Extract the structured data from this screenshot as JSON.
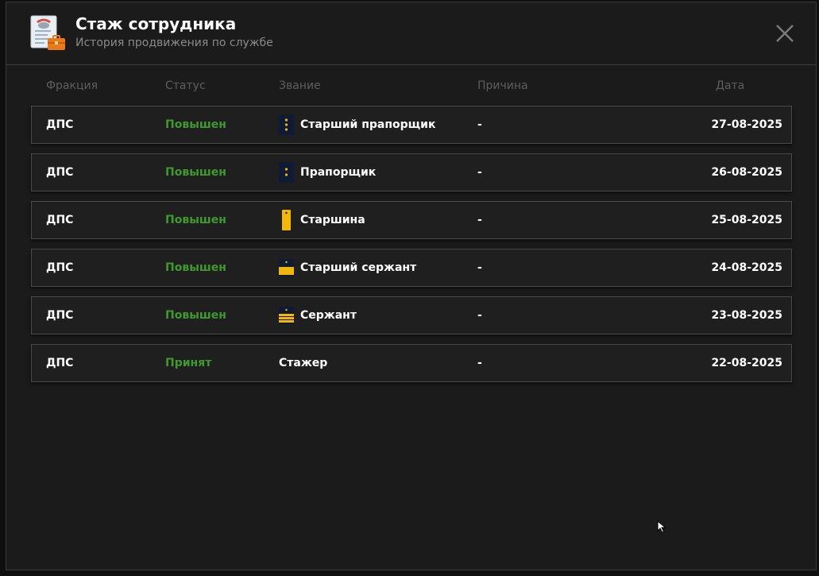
{
  "header": {
    "title": "Стаж сотрудника",
    "subtitle": "История продвижения по службе"
  },
  "columns": {
    "faction": "Фракция",
    "status": "Статус",
    "rank": "Звание",
    "reason": "Причина",
    "date": "Дата"
  },
  "rows": [
    {
      "faction": "ДПС",
      "status": "Повышен",
      "rank": "Старший прапорщик",
      "rank_icon": "ensign-3-stars-icon",
      "reason": "-",
      "date": "27-08-2025"
    },
    {
      "faction": "ДПС",
      "status": "Повышен",
      "rank": "Прапорщик",
      "rank_icon": "ensign-2-stars-icon",
      "reason": "-",
      "date": "26-08-2025"
    },
    {
      "faction": "ДПС",
      "status": "Повышен",
      "rank": "Старшина",
      "rank_icon": "starshina-stripe-icon",
      "reason": "-",
      "date": "25-08-2025"
    },
    {
      "faction": "ДПС",
      "status": "Повышен",
      "rank": "Старший сержант",
      "rank_icon": "senior-sergeant-wide-stripe-icon",
      "reason": "-",
      "date": "24-08-2025"
    },
    {
      "faction": "ДПС",
      "status": "Повышен",
      "rank": "Сержант",
      "rank_icon": "sergeant-three-stripes-icon",
      "reason": "-",
      "date": "23-08-2025"
    },
    {
      "faction": "ДПС",
      "status": "Принят",
      "rank": "Стажер",
      "rank_icon": "",
      "reason": "-",
      "date": "22-08-2025"
    }
  ],
  "colors": {
    "status_green": "#3f9a2c",
    "rank_gold": "#f3b70b",
    "rank_navy": "#0f1a34"
  }
}
